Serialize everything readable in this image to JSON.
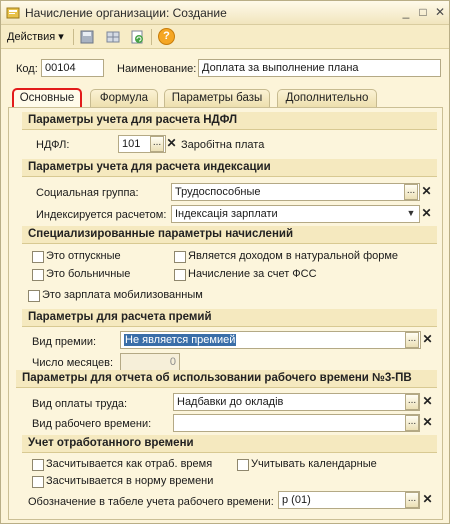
{
  "window": {
    "title": "Начисление организации: Создание",
    "minimize_glyph": "_",
    "maximize_glyph": "□",
    "close_glyph": "✕"
  },
  "toolbar": {
    "actions_label": "Действия",
    "actions_arrow": "▾",
    "help_glyph": "?"
  },
  "header": {
    "code_label": "Код:",
    "code_value": "00104",
    "name_label": "Наименование:",
    "name_value": "Доплата за выполнение плана"
  },
  "tabs": [
    {
      "label": "Основные",
      "active": true
    },
    {
      "label": "Формула",
      "active": false
    },
    {
      "label": "Параметры базы",
      "active": false
    },
    {
      "label": "Дополнительно",
      "active": false
    }
  ],
  "ndfl_section": {
    "title": "Параметры учета для расчета НДФЛ",
    "ndfl_label": "НДФЛ:",
    "ndfl_code": "101",
    "ndfl_desc": "Заробітна плата"
  },
  "indexation_section": {
    "title": "Параметры учета для расчета индексации",
    "social_group_label": "Социальная группа:",
    "social_group_value": "Трудоспособные",
    "indexed_by_label": "Индексируется расчетом:",
    "indexed_by_value": "Індексація зарплати"
  },
  "special_section": {
    "title": "Специализированные параметры начислений",
    "checkboxes": [
      {
        "label": "Это отпускные",
        "checked": false
      },
      {
        "label": "Является доходом в натуральной форме",
        "checked": false
      },
      {
        "label": "Это больничные",
        "checked": false
      },
      {
        "label": "Начисление за счет ФСС",
        "checked": false
      },
      {
        "label": "Это зарплата мобилизованным",
        "checked": false
      }
    ]
  },
  "bonus_section": {
    "title": "Параметры для расчета премий",
    "bonus_type_label": "Вид премии:",
    "bonus_type_value": "Не является премией",
    "months_label": "Число месяцев:",
    "months_value": "0"
  },
  "report_section": {
    "title": "Параметры для отчета об использовании рабочего времени №3-ПВ",
    "pay_type_label": "Вид оплаты труда:",
    "pay_type_value": "Надбавки до окладів",
    "worktime_type_label": "Вид рабочего времени:",
    "worktime_type_value": ""
  },
  "worked_section": {
    "title": "Учет отработанного времени",
    "checkboxes": [
      {
        "label": "Засчитывается как отраб. время",
        "checked": false
      },
      {
        "label": "Учитывать календарные",
        "checked": false
      },
      {
        "label": "Засчитывается в норму времени",
        "checked": false
      }
    ],
    "timesheet_label": "Обозначение в табеле учета рабочего времени:",
    "timesheet_value": "р (01)"
  },
  "glyphs": {
    "ellipsis": "...",
    "clear": "✕",
    "dropdown": "▼",
    "spin": "▲▼"
  }
}
